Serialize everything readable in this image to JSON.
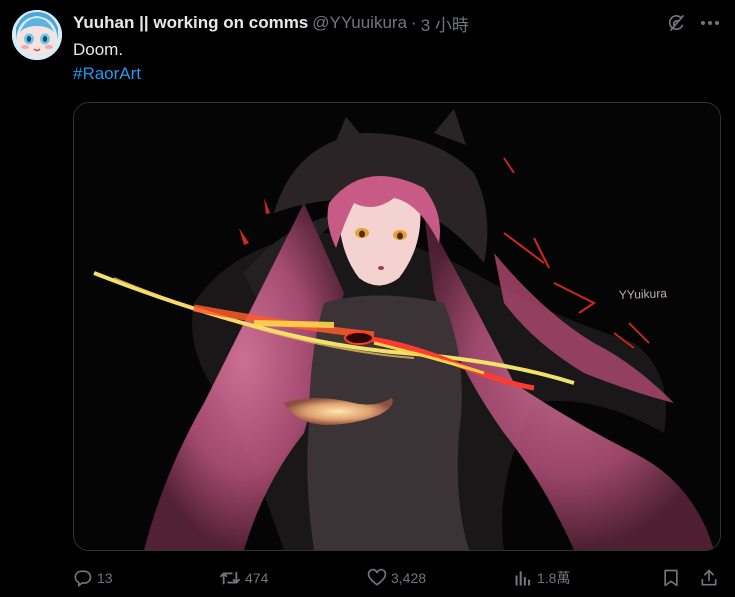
{
  "author": {
    "display_name": "Yuuhan || working on comms",
    "handle": "@YYuuikura",
    "separator": "·",
    "time": "3 小時"
  },
  "tweet": {
    "text": "Doom.",
    "hashtag": "#RaorArt"
  },
  "media": {
    "watermark": "YYuikura"
  },
  "actions": {
    "replies": "13",
    "retweets": "474",
    "likes": "3,428",
    "views": "1.8萬"
  },
  "colors": {
    "background": "#000000",
    "text_primary": "#e7e9ea",
    "text_secondary": "#71767b",
    "link": "#1d9bf0",
    "border": "#2f3336"
  },
  "icons": {
    "grok": "grok-icon",
    "more": "more-icon",
    "reply": "reply-icon",
    "retweet": "retweet-icon",
    "like": "heart-icon",
    "views": "views-icon",
    "bookmark": "bookmark-icon",
    "share": "share-icon"
  }
}
